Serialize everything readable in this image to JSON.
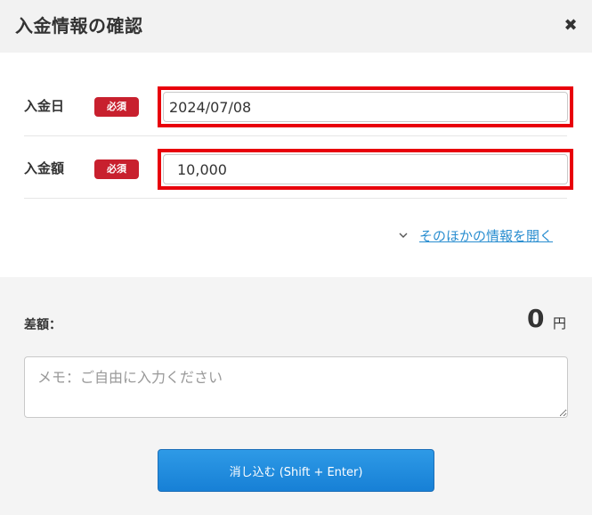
{
  "dialog": {
    "title": "入金情報の確認",
    "close_icon": "✖"
  },
  "form": {
    "rows": [
      {
        "label": "入金日",
        "required_badge": "必須",
        "value": "2024/07/08"
      },
      {
        "label": "入金額",
        "required_badge": "必須",
        "value": "10,000"
      }
    ],
    "more_link": "そのほかの情報を開く"
  },
  "summary": {
    "difference_label": "差額：",
    "difference_value": "0",
    "difference_unit": "円"
  },
  "memo": {
    "placeholder": "メモ：ご自由に入力ください",
    "value": ""
  },
  "actions": {
    "submit_label": "消し込む (Shift + Enter)"
  },
  "colors": {
    "badge": "#c8202e",
    "highlight": "#e8000b",
    "link": "#2a8ed0",
    "button": "#1780d6"
  }
}
